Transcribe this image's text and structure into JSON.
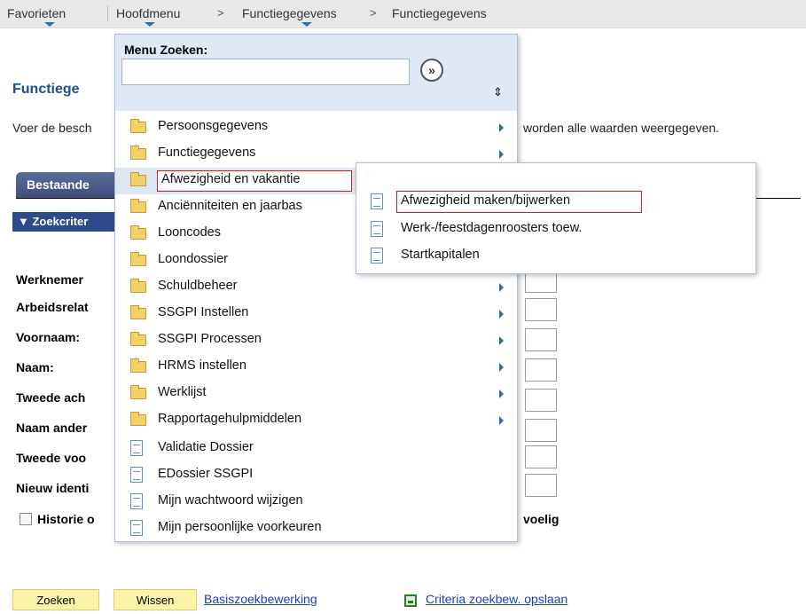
{
  "navbar": {
    "favorites": "Favorieten",
    "main_menu": "Hoofdmenu",
    "sep": ">",
    "crumb1": "Functiegegevens",
    "crumb2": "Functiegegevens"
  },
  "page": {
    "title": "Functiege",
    "description": "Voer de besch",
    "description_right": "worden alle waarden weergegeven.",
    "tab": "Bestaande",
    "criteria_header": "▼ Zoekcriter",
    "fields": [
      "Werknemer",
      "Arbeidsrelat",
      "Voornaam:",
      "Naam:",
      "Tweede ach",
      "Naam ander",
      "Tweede voo",
      "Nieuw identi"
    ],
    "checkbox_label": "Historie o",
    "checkbox_label_right": "voelig"
  },
  "actions": {
    "search": "Zoeken",
    "clear": "Wissen",
    "basic_search": "Basiszoekbewerking",
    "save_criteria": "Criteria zoekbew. opslaan"
  },
  "menu": {
    "search_label": "Menu Zoeken:",
    "search_value": "",
    "go_icon": "»",
    "sort_icon": "⇕",
    "items": [
      {
        "label": "Persoonsgegevens",
        "type": "folder",
        "arrow": true
      },
      {
        "label": "Functiegegevens",
        "type": "folder",
        "arrow": true
      },
      {
        "label": "Afwezigheid en vakantie",
        "type": "folder",
        "arrow": false
      },
      {
        "label": "Anciënniteiten en jaarbas",
        "type": "folder",
        "arrow": false
      },
      {
        "label": "Looncodes",
        "type": "folder",
        "arrow": false
      },
      {
        "label": "Loondossier",
        "type": "folder",
        "arrow": false
      },
      {
        "label": "Schuldbeheer",
        "type": "folder",
        "arrow": true
      },
      {
        "label": "SSGPI Instellen",
        "type": "folder",
        "arrow": true
      },
      {
        "label": "SSGPI Processen",
        "type": "folder",
        "arrow": true
      },
      {
        "label": "HRMS instellen",
        "type": "folder",
        "arrow": true
      },
      {
        "label": "Werklijst",
        "type": "folder",
        "arrow": true
      },
      {
        "label": "Rapportagehulpmiddelen",
        "type": "folder",
        "arrow": true
      },
      {
        "label": "Validatie Dossier",
        "type": "doc",
        "arrow": false
      },
      {
        "label": "EDossier SSGPI",
        "type": "doc",
        "arrow": false
      },
      {
        "label": "Mijn wachtwoord wijzigen",
        "type": "doc",
        "arrow": false
      },
      {
        "label": "Mijn persoonlijke voorkeuren",
        "type": "doc",
        "arrow": false
      }
    ]
  },
  "submenu": {
    "items": [
      {
        "label": "Afwezigheid maken/bijwerken"
      },
      {
        "label": "Werk-/feestdagenroosters toew."
      },
      {
        "label": "Startkapitalen"
      }
    ]
  }
}
